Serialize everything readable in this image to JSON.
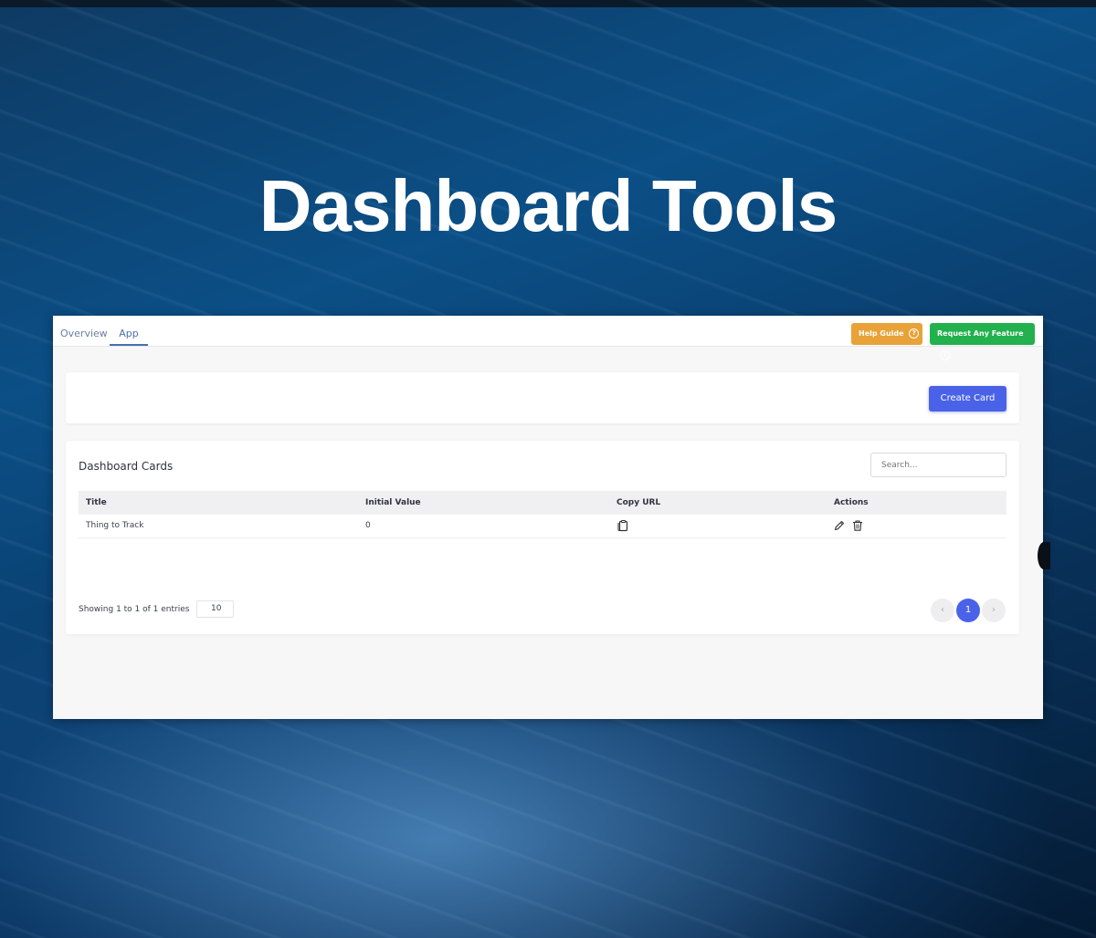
{
  "hero": {
    "title": "Dashboard Tools"
  },
  "tabs": [
    {
      "label": "Overview",
      "active": false
    },
    {
      "label": "App",
      "active": true
    }
  ],
  "header_buttons": {
    "help_label": "Help Guide",
    "help_icon": "?",
    "request_label": "Request Any Feature",
    "request_icon": "!"
  },
  "create_button": {
    "label": "Create Card"
  },
  "cards_table": {
    "title": "Dashboard Cards",
    "search_placeholder": "Search...",
    "columns": [
      "Title",
      "Initial Value",
      "Copy URL",
      "Actions"
    ],
    "rows": [
      {
        "title": "Thing to Track",
        "initial_value": "0",
        "copy_icon": "copy-icon",
        "actions": [
          "edit-icon",
          "trash-icon"
        ]
      }
    ],
    "footer_text": "Showing 1 to 1 of 1 entries",
    "page_length": "10",
    "pagination": {
      "prev": "‹",
      "current": "1",
      "next": "›"
    }
  },
  "colors": {
    "primary": "#4a62e8",
    "help": "#e8a238",
    "request": "#22b14c"
  }
}
